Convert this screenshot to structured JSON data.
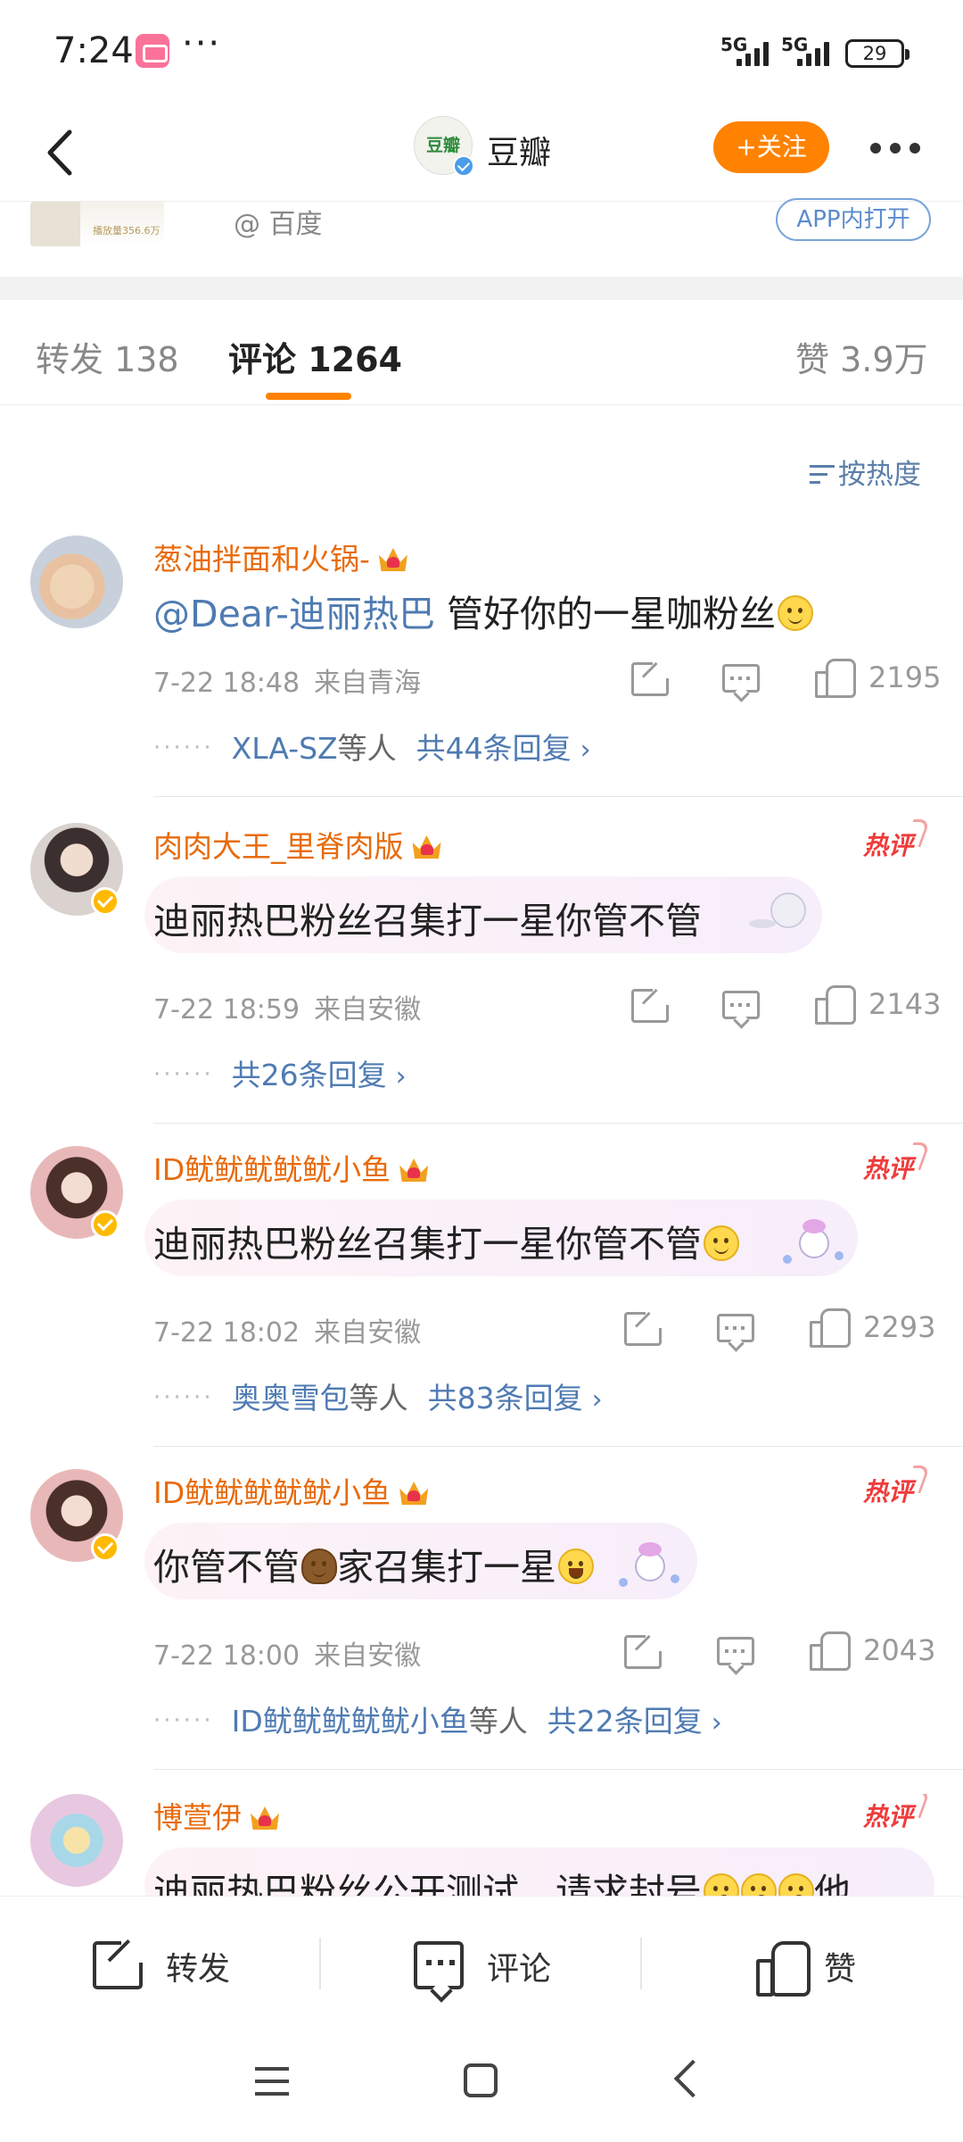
{
  "status_bar": {
    "time": "7:24",
    "net1": "5G",
    "net2": "5G",
    "battery": "29"
  },
  "nav": {
    "avatar_text": "豆瓣",
    "title": "豆瓣",
    "follow_label": "+关注"
  },
  "source": {
    "text": "@ 百度",
    "thumb_text": "播放量356.6万",
    "open_app_label": "APP内打开"
  },
  "tabs": [
    {
      "label": "转发 138"
    },
    {
      "label": "评论 1264"
    },
    {
      "label": "赞 3.9万"
    }
  ],
  "sort_label": "按热度",
  "comments": [
    {
      "name": "葱油拌面和火锅-",
      "mention": "@Dear-迪丽热巴",
      "text": " 管好你的一星咖粉丝",
      "time": "7-22 18:48",
      "location": "来自青海",
      "likes": "2195",
      "reply_users": "XLA-SZ",
      "reply_users_suffix": "等人",
      "replies": "共44条回复"
    },
    {
      "name": "肉肉大王_里脊肉版",
      "hot": "热评",
      "text": "迪丽热巴粉丝召集打一星你管不管",
      "time": "7-22 18:59",
      "location": "来自安徽",
      "likes": "2143",
      "replies": "共26条回复"
    },
    {
      "name": "ID鱿鱿鱿鱿鱿小鱼",
      "hot": "热评",
      "text": "迪丽热巴粉丝召集打一星你管不管",
      "time": "7-22 18:02",
      "location": "来自安徽",
      "likes": "2293",
      "reply_users": "奥奥雪包",
      "reply_users_suffix": "等人",
      "replies": "共83条回复"
    },
    {
      "name": "ID鱿鱿鱿鱿鱿小鱼",
      "hot": "热评",
      "text_a": "你管不管",
      "text_b": "家召集打一星",
      "time": "7-22 18:00",
      "location": "来自安徽",
      "likes": "2043",
      "reply_users": "ID鱿鱿鱿鱿鱿小鱼",
      "reply_users_suffix": "等人",
      "replies": "共22条回复"
    },
    {
      "name": "博萱伊",
      "hot": "热评",
      "text_a": "迪丽热巴粉丝公开测试，请求封号",
      "text_b": "他"
    }
  ],
  "bottom_bar": {
    "share": "转发",
    "comment": "评论",
    "like": "赞"
  },
  "colors": {
    "accent": "#ff8200",
    "name": "#e86b0c",
    "link": "#4f7bb2",
    "hot": "#ef3b3b"
  }
}
